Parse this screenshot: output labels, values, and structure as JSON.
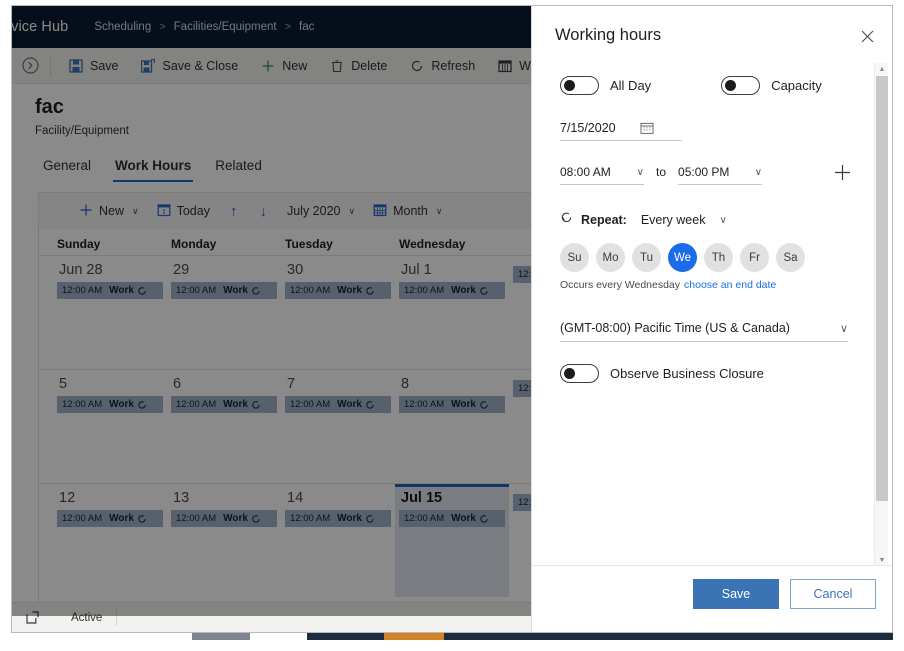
{
  "nav": {
    "app_name": "ervice Hub",
    "breadcrumb": [
      "Scheduling",
      "Facilities/Equipment",
      "fac"
    ],
    "separator": ">"
  },
  "commandbar": {
    "history_icon": "clock-history-icon",
    "items": [
      {
        "label": "Save",
        "icon": "save-icon"
      },
      {
        "label": "Save & Close",
        "icon": "save-and-close-icon"
      },
      {
        "label": "New",
        "icon": "plus-icon"
      },
      {
        "label": "Delete",
        "icon": "trash-icon"
      },
      {
        "label": "Refresh",
        "icon": "refresh-icon"
      },
      {
        "label": "Work H",
        "icon": "calendar-grid-icon"
      }
    ]
  },
  "record": {
    "title": "fac",
    "subtitle": "Facility/Equipment"
  },
  "tabs": [
    {
      "label": "General",
      "active": false
    },
    {
      "label": "Work Hours",
      "active": true
    },
    {
      "label": "Related",
      "active": false
    }
  ],
  "calendar": {
    "toolbar": {
      "new_label": "New",
      "today_label": "Today",
      "prev_label": "↑",
      "next_label": "↓",
      "period_label": "July 2020",
      "view_label": "Month",
      "chevron": "∨"
    },
    "day_headers": [
      "Sunday",
      "Monday",
      "Tuesday",
      "Wednesday"
    ],
    "event_time": "12:00 AM",
    "event_label": "Work",
    "event_recurrence_icon": "recurrence-icon",
    "weeks": [
      {
        "cells": [
          {
            "day": "Jun 28",
            "selected": false,
            "has_event": true
          },
          {
            "day": "29",
            "selected": false,
            "has_event": true
          },
          {
            "day": "30",
            "selected": false,
            "has_event": true
          },
          {
            "day": "Jul 1",
            "selected": false,
            "has_event": true
          },
          {
            "day": "",
            "selected": false,
            "has_event": true
          }
        ]
      },
      {
        "cells": [
          {
            "day": "5",
            "selected": false,
            "has_event": true
          },
          {
            "day": "6",
            "selected": false,
            "has_event": true
          },
          {
            "day": "7",
            "selected": false,
            "has_event": true
          },
          {
            "day": "8",
            "selected": false,
            "has_event": true
          },
          {
            "day": "",
            "selected": false,
            "has_event": true
          }
        ]
      },
      {
        "cells": [
          {
            "day": "12",
            "selected": false,
            "has_event": true
          },
          {
            "day": "13",
            "selected": false,
            "has_event": true
          },
          {
            "day": "14",
            "selected": false,
            "has_event": true
          },
          {
            "day": "Jul 15",
            "selected": true,
            "has_event": true
          },
          {
            "day": "",
            "selected": false,
            "has_event": true
          }
        ]
      }
    ]
  },
  "statusbar": {
    "icon": "open-in-new-window-icon",
    "status": "Active"
  },
  "panel": {
    "title": "Working hours",
    "close_icon": "close-icon",
    "toggles": [
      {
        "label": "All Day",
        "on": false
      },
      {
        "label": "Capacity",
        "on": false
      }
    ],
    "date": {
      "value": "7/15/2020",
      "icon": "calendar-picker-icon"
    },
    "time": {
      "start": "08:00 AM",
      "to_label": "to",
      "end": "05:00 PM",
      "chevron": "∨",
      "add_icon": "plus-icon"
    },
    "repeat": {
      "icon": "recurrence-icon",
      "label": "Repeat:",
      "value": "Every week",
      "chevron": "∨"
    },
    "days": [
      {
        "label": "Su",
        "selected": false
      },
      {
        "label": "Mo",
        "selected": false
      },
      {
        "label": "Tu",
        "selected": false
      },
      {
        "label": "We",
        "selected": true
      },
      {
        "label": "Th",
        "selected": false
      },
      {
        "label": "Fr",
        "selected": false
      },
      {
        "label": "Sa",
        "selected": false
      }
    ],
    "occurs_text": "Occurs every Wednesday",
    "end_date_link": "choose an end date",
    "timezone": {
      "value": "(GMT-08:00) Pacific Time (US & Canada)",
      "chevron": "∨"
    },
    "closure_toggle": {
      "label": "Observe Business Closure",
      "on": false
    },
    "footer": {
      "save_label": "Save",
      "cancel_label": "Cancel"
    },
    "scrollbar": {
      "up": "▲",
      "down": "▼"
    }
  },
  "colors": {
    "nav_bg": "#0a1c33",
    "accent_blue": "#2266c9",
    "selected_day_blue": "#1b6ce8",
    "event_chip": "#9fb4c9",
    "save_button": "#3a74b5",
    "taskbar": "#1b2c40",
    "taskbar_orange": "#d4822a"
  }
}
